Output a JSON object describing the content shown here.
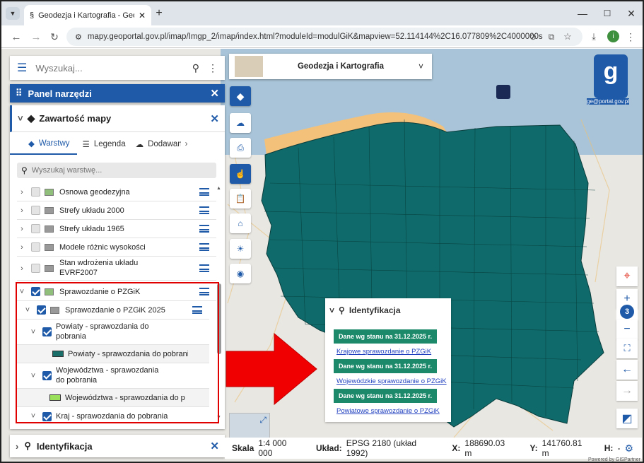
{
  "browser": {
    "tab_title": "Geodezja i Kartografia - Geopo",
    "url": "mapy.geoportal.gov.pl/imap/Imgp_2/imap/index.html?moduleId=modulGiK&mapview=52.114144%2C16.077809%2C4000000s",
    "avatar_letter": "i"
  },
  "search": {
    "placeholder": "Wyszukaj..."
  },
  "toolbox": {
    "title": "Panel narzędzi"
  },
  "content_panel": {
    "title": "Zawartość mapy",
    "tabs": [
      "Warstwy",
      "Legenda",
      "Dodawani"
    ],
    "layer_search_placeholder": "Wyszukaj warstwę..."
  },
  "layers": [
    {
      "label": "Osnowa geodezyjna",
      "checked": false
    },
    {
      "label": "Strefy układu 2000",
      "checked": false
    },
    {
      "label": "Strefy układu 1965",
      "checked": false
    },
    {
      "label": "Modele różnic wysokości",
      "checked": false
    },
    {
      "label": "Stan wdrożenia układu EVRF2007",
      "checked": false
    },
    {
      "label": "Sprawozdanie o PZGiK",
      "checked": true
    },
    {
      "label": "Sprawozdanie o PZGiK 2025",
      "checked": true
    },
    {
      "label": "Powiaty - sprawozdania do pobrania",
      "checked": true
    },
    {
      "label": "Powiaty - sprawozdania do pobrania",
      "legend": true,
      "color": "#1a6e6a"
    },
    {
      "label": "Województwa - sprawozdania do pobrania",
      "checked": true
    },
    {
      "label": "Województwa - sprawozdania do po",
      "legend": true,
      "color": "#9be05a"
    },
    {
      "label": "Kraj - sprawozdania do pobrania",
      "checked": true
    }
  ],
  "bottom_panel": {
    "title": "Identyfikacja"
  },
  "module_selector": {
    "label": "Geodezja i Kartografia"
  },
  "logo_text": "ge@portal.gov.pl",
  "identification": {
    "title": "Identyfikacja",
    "entries": [
      {
        "badge": "Dane wg stanu na 31.12.2025 r.",
        "link": "Krajowe sprawozdanie o PZGiK"
      },
      {
        "badge": "Dane wg stanu na 31.12.2025 r.",
        "link": "Wojewódzkie sprawozdanie o PZGiK"
      },
      {
        "badge": "Dane wg stanu na 31.12.2025 r.",
        "link": "Powiatowe sprawozdanie o PZGiK"
      }
    ]
  },
  "zoom": {
    "level": "3"
  },
  "statusbar": {
    "scale_label": "Skala",
    "scale_value": "1:4 000 000",
    "crs_label": "Układ:",
    "crs_value": "EPSG 2180 (układ 1992)",
    "x_label": "X:",
    "x_value": "188690.03 m",
    "y_label": "Y:",
    "y_value": "141760.81 m",
    "h_label": "H:",
    "h_value": "-"
  },
  "footer_credit": "Powered by GISPartner",
  "colors": {
    "brand_blue": "#1f5aa8",
    "poland_fill": "#0f6b6b",
    "highlight_red": "#e00000",
    "badge_green": "#1c8a6a"
  }
}
